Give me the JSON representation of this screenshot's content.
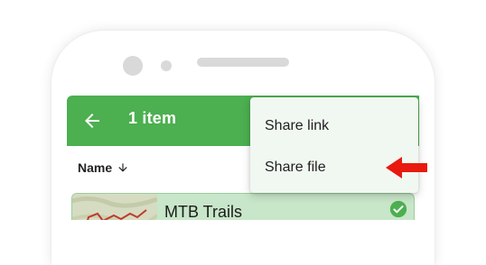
{
  "appbar": {
    "title": "1 item",
    "color": "#4caf50",
    "back_icon": "arrow-left-icon"
  },
  "sort": {
    "label": "Name",
    "icon": "arrow-down-icon"
  },
  "list": {
    "items": [
      {
        "title": "MTB Trails",
        "selected": true,
        "thumbnail": "map-thumbnail",
        "status_icon": "check-circle-icon"
      }
    ],
    "selected_color": "#c8e6c9"
  },
  "menu": {
    "items": [
      {
        "label": "Share link"
      },
      {
        "label": "Share file"
      }
    ]
  },
  "annotation": {
    "icon": "red-arrow-icon",
    "color": "#e8190f"
  }
}
